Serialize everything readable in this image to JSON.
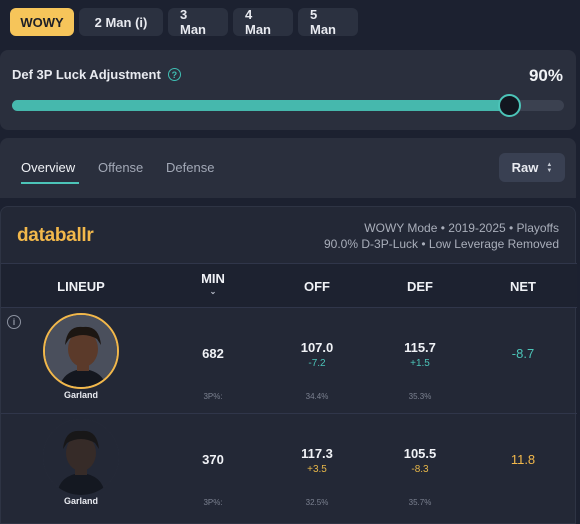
{
  "mode_tabs": [
    {
      "label": "WOWY",
      "active": true
    },
    {
      "label": "2 Man (i)",
      "active": false
    },
    {
      "label": "3 Man",
      "active": false
    },
    {
      "label": "4 Man",
      "active": false
    },
    {
      "label": "5 Man",
      "active": false
    }
  ],
  "slider": {
    "label": "Def 3P Luck Adjustment",
    "value_text": "90%",
    "value": 0.9
  },
  "view_tabs": [
    {
      "label": "Overview",
      "active": true
    },
    {
      "label": "Offense",
      "active": false
    },
    {
      "label": "Defense",
      "active": false
    }
  ],
  "display_select": "Raw",
  "brand": "databallr",
  "meta": {
    "line1": "WOWY Mode • 2019-2025 • Playoffs",
    "line2": "90.0% D-3P-Luck • Low Leverage Removed"
  },
  "columns": {
    "lineup": "LINEUP",
    "min": "MIN",
    "off": "OFF",
    "def": "DEF",
    "net": "NET"
  },
  "rows": [
    {
      "player": "Garland",
      "min": "682",
      "off": "107.0",
      "off_diff": "-7.2",
      "off_3p": "34.4%",
      "def": "115.7",
      "def_diff": "+1.5",
      "def_3p": "35.3%",
      "net": "-8.7",
      "three_label": "3P%:"
    },
    {
      "player": "Garland",
      "min": "370",
      "off": "117.3",
      "off_diff": "+3.5",
      "off_3p": "32.5%",
      "def": "105.5",
      "def_diff": "-8.3",
      "def_3p": "35.7%",
      "net": "11.8",
      "three_label": "3P%:"
    }
  ],
  "colors": {
    "accent_gold": "#f6c55a",
    "accent_teal": "#4cc4b8",
    "bg": "#1c2130"
  },
  "icons": {
    "help": "question-circle",
    "info": "info-circle",
    "sort": "chevron-down",
    "select": "up-down-chevrons"
  }
}
